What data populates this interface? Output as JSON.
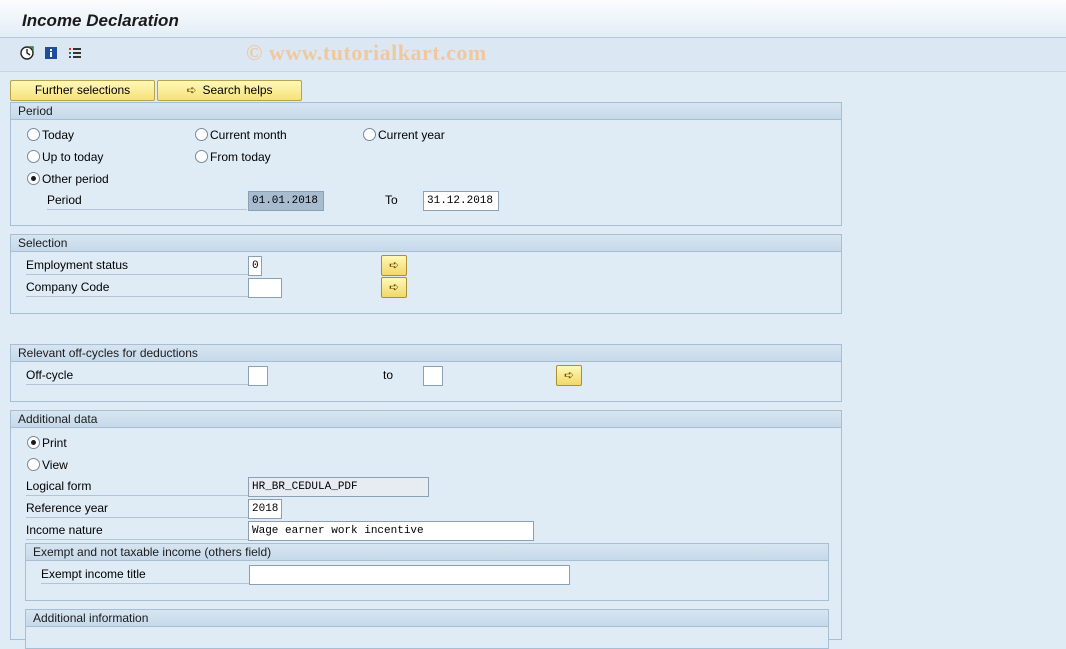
{
  "window": {
    "title": "Income Declaration"
  },
  "watermark": "© www.tutorialkart.com",
  "toolbar": {
    "icons": [
      "execute-icon",
      "info-icon",
      "variant-list-icon"
    ]
  },
  "selection_buttons": {
    "further": "Further selections",
    "search": "Search helps"
  },
  "period": {
    "header": "Period",
    "options": {
      "today": "Today",
      "current_month": "Current month",
      "current_year": "Current year",
      "up_to_today": "Up to today",
      "from_today": "From today",
      "other_period": "Other period"
    },
    "selected": "other_period",
    "period_label": "Period",
    "from_value": "01.01.2018",
    "to_label": "To",
    "to_value": "31.12.2018"
  },
  "selection": {
    "header": "Selection",
    "employment_status_label": "Employment status",
    "employment_status_value": "0",
    "company_code_label": "Company Code",
    "company_code_value": ""
  },
  "offcycles": {
    "header": "Relevant off-cycles for deductions",
    "offcycle_label": "Off-cycle",
    "from_value": "",
    "to_label": "to",
    "to_value": ""
  },
  "additional": {
    "header": "Additional data",
    "print_label": "Print",
    "view_label": "View",
    "selected": "print",
    "logical_form_label": "Logical form",
    "logical_form_value": "HR_BR_CEDULA_PDF",
    "reference_year_label": "Reference year",
    "reference_year_value": "2018",
    "income_nature_label": "Income nature",
    "income_nature_value": "Wage earner work incentive",
    "exempt_group": {
      "header": "Exempt and not taxable income (others field)",
      "title_label": "Exempt income title",
      "title_value": ""
    },
    "info_group": {
      "header": "Additional information"
    }
  },
  "colors": {
    "background": "#dfebf5",
    "button": "#f6e27a",
    "header": "#c6d9ea"
  }
}
